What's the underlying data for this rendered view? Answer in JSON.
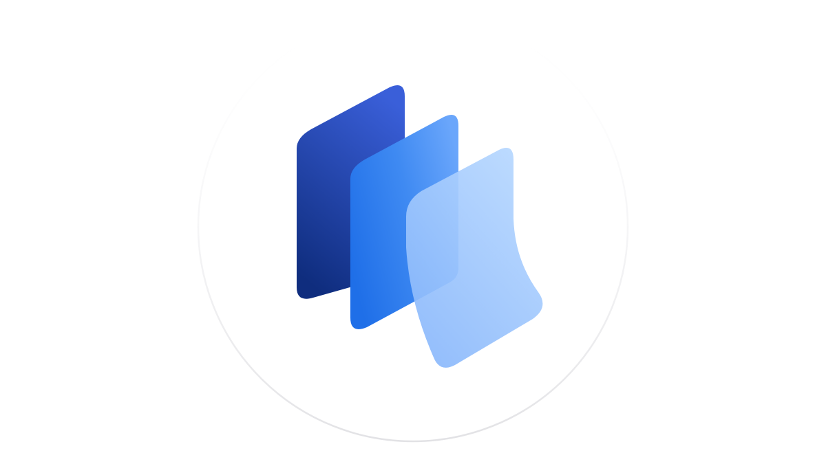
{
  "icon": "stacked-layers-logo-icon",
  "colors": {
    "background": "#ffffff",
    "circle_fill": "#ffffff",
    "circle_edge": "#e4e4e6",
    "back_panel_top": "#3a5fd9",
    "back_panel_bottom": "#0f2d7e",
    "middle_panel_dark": "#1f6fe8",
    "middle_panel_light": "#6aa6fb",
    "front_panel_light": "#b9d9ff",
    "front_panel_dark": "#8ab8fb"
  }
}
